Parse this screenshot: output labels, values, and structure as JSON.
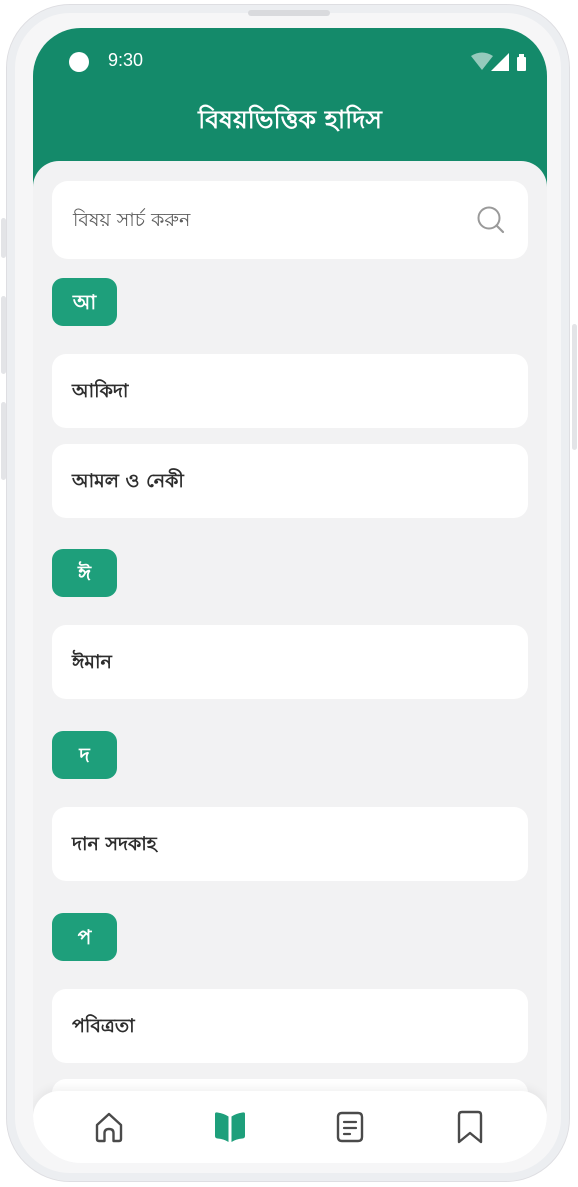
{
  "status_bar": {
    "time": "9:30"
  },
  "header": {
    "title": "বিষয়ভিত্তিক হাদিস"
  },
  "search": {
    "placeholder": "বিষয় সার্চ করুন"
  },
  "sections": [
    {
      "letter": "আ",
      "items": [
        "আকিদা",
        "আমল ও নেকী"
      ]
    },
    {
      "letter": "ঈ",
      "items": [
        "ঈমান"
      ]
    },
    {
      "letter": "দ",
      "items": [
        "দান সদকাহ"
      ]
    },
    {
      "letter": "প",
      "items": [
        "পবিত্রতা"
      ]
    }
  ],
  "bottom_nav": {
    "items": [
      {
        "icon": "home-icon",
        "active": false
      },
      {
        "icon": "book-open-icon",
        "active": true
      },
      {
        "icon": "document-icon",
        "active": false
      },
      {
        "icon": "bookmark-icon",
        "active": false
      }
    ]
  },
  "colors": {
    "primary": "#148a6a",
    "badge": "#1e9f7b",
    "background": "#f2f2f3",
    "card": "#ffffff",
    "text": "#2d2d2d"
  }
}
